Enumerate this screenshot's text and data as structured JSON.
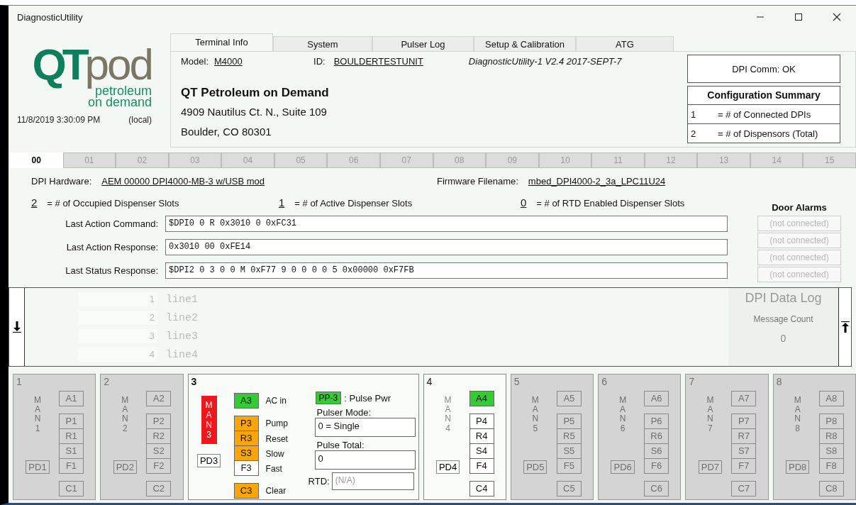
{
  "window": {
    "title": "DiagnosticUtility"
  },
  "logo": {
    "letters_1": "QT",
    "letters_2": "pod",
    "tagline_1": "petroleum",
    "tagline_2": "on demand"
  },
  "clock": {
    "time": "11/8/2019 3:30:09 PM",
    "zone": "(local)"
  },
  "tabs": [
    {
      "label": "Terminal Info",
      "selected": true
    },
    {
      "label": "System",
      "selected": false
    },
    {
      "label": "Pulser Log",
      "selected": false
    },
    {
      "label": "Setup & Calibration",
      "selected": false
    },
    {
      "label": "ATG",
      "selected": false
    }
  ],
  "terminal": {
    "model_label": "Model:",
    "model": "M4000",
    "id_label": "ID:",
    "id": "BOULDERTESTUNIT",
    "version": "DiagnosticUtility-1 V2.4 2017-SEPT-7",
    "company": "QT Petroleum on Demand",
    "address_1": "4909 Nautilus Ct. N., Suite 109",
    "address_2": "Boulder, CO 80301"
  },
  "comm_status": "DPI Comm: OK",
  "config_summary": {
    "title": "Configuration Summary",
    "rows": [
      {
        "count": "1",
        "label": "= # of Connected DPIs"
      },
      {
        "count": "2",
        "label": "= # of Dispensors (Total)"
      }
    ]
  },
  "dpi_tabs": [
    {
      "label": "00",
      "selected": true
    },
    {
      "label": "01",
      "selected": false
    },
    {
      "label": "02",
      "selected": false
    },
    {
      "label": "03",
      "selected": false
    },
    {
      "label": "04",
      "selected": false
    },
    {
      "label": "05",
      "selected": false
    },
    {
      "label": "06",
      "selected": false
    },
    {
      "label": "07",
      "selected": false
    },
    {
      "label": "08",
      "selected": false
    },
    {
      "label": "09",
      "selected": false
    },
    {
      "label": "10",
      "selected": false
    },
    {
      "label": "11",
      "selected": false
    },
    {
      "label": "12",
      "selected": false
    },
    {
      "label": "13",
      "selected": false
    },
    {
      "label": "14",
      "selected": false
    },
    {
      "label": "15",
      "selected": false
    }
  ],
  "dpi": {
    "hardware_label": "DPI Hardware:",
    "hardware": "AEM 00000 DPI4000-MB-3 w/USB mod",
    "firmware_label": "Firmware Filename:",
    "firmware": "mbed_DPI4000-2_3a_LPC11U24",
    "counts": [
      {
        "count": "2",
        "label": "= # of Occupied Dispenser Slots"
      },
      {
        "count": "1",
        "label": "= # of Active Dispenser Slots"
      },
      {
        "count": "0",
        "label": "= # of RTD Enabled Dispenser Slots"
      }
    ],
    "fields": [
      {
        "label": "Last Action Command:",
        "value": "$DPI0 0 R 0x3010 0 0xFC31"
      },
      {
        "label": "Last Action Response:",
        "value": "0x3010 00 0xFE14"
      },
      {
        "label": "Last Status Response:",
        "value": "$DPI2 0 3 0 0 M 0xF77 9 0 0 0 0 5 0x00000 0xF7FB"
      }
    ]
  },
  "door_alarms": {
    "title": "Door Alarms",
    "buttons": [
      {
        "label": "(not connected)",
        "disabled": true
      },
      {
        "label": "(not connected)",
        "disabled": true
      },
      {
        "label": "(not connected)",
        "disabled": true
      },
      {
        "label": "(not connected)",
        "disabled": true
      }
    ]
  },
  "data_log": {
    "lines": [
      {
        "number": "1",
        "text": "line1"
      },
      {
        "number": "2",
        "text": "line2"
      },
      {
        "number": "3",
        "text": "line3"
      },
      {
        "number": "4",
        "text": "line4"
      }
    ],
    "title": "DPI Data Log",
    "count_label": "Message Count",
    "count": "0"
  },
  "slots": [
    {
      "number": "1",
      "kind": "compact",
      "enabled": false,
      "man": "MAN1",
      "man_alarm": false,
      "pd": "PD1",
      "indicators": [
        {
          "label": "A1",
          "color": "#d4d4d4"
        },
        {
          "label": "P1",
          "color": "#d4d4d4"
        },
        {
          "label": "R1",
          "color": "#d4d4d4"
        },
        {
          "label": "S1",
          "color": "#d4d4d4"
        },
        {
          "label": "F1",
          "color": "#d4d4d4"
        },
        {
          "label": "C1",
          "color": "#d4d4d4"
        }
      ]
    },
    {
      "number": "2",
      "kind": "compact",
      "enabled": false,
      "man": "MAN2",
      "man_alarm": false,
      "pd": "PD2",
      "indicators": [
        {
          "label": "A2",
          "color": "#d4d4d4"
        },
        {
          "label": "P2",
          "color": "#d4d4d4"
        },
        {
          "label": "R2",
          "color": "#d4d4d4"
        },
        {
          "label": "S2",
          "color": "#d4d4d4"
        },
        {
          "label": "F2",
          "color": "#d4d4d4"
        },
        {
          "label": "C2",
          "color": "#d4d4d4"
        }
      ]
    },
    {
      "number": "3",
      "kind": "detailed",
      "enabled": true,
      "man": "MAN3",
      "man_alarm": true,
      "pd": "PD3",
      "indicators": [
        {
          "label": "A3",
          "color": "#33cc33",
          "caption": "AC in"
        },
        {
          "label": "P3",
          "color": "#ffa500",
          "caption": "Pump"
        },
        {
          "label": "R3",
          "color": "#ffa500",
          "caption": "Reset"
        },
        {
          "label": "S3",
          "color": "#ffa500",
          "caption": "Slow"
        },
        {
          "label": "F3",
          "color": "#ffffff",
          "caption": "Fast"
        },
        {
          "label": "C3",
          "color": "#ffa500",
          "caption": "Clear"
        }
      ],
      "pulse_power": {
        "badge": "PP-3",
        "color": "#33cc33",
        "label": ": Pulse Pwr"
      },
      "pulser_mode": {
        "label": "Pulser Mode:",
        "value": "0 = Single"
      },
      "pulse_total": {
        "label": "Pulse Total:",
        "value": "0"
      },
      "rtd": {
        "label": "RTD:",
        "value": "(N/A)",
        "disabled": true
      }
    },
    {
      "number": "4",
      "kind": "compact",
      "enabled": true,
      "man": "MAN4",
      "man_alarm": false,
      "pd": "PD4",
      "indicators": [
        {
          "label": "A4",
          "color": "#33cc33"
        },
        {
          "label": "P4",
          "color": "#ffffff"
        },
        {
          "label": "R4",
          "color": "#ffffff"
        },
        {
          "label": "S4",
          "color": "#ffffff"
        },
        {
          "label": "F4",
          "color": "#ffffff"
        },
        {
          "label": "C4",
          "color": "#ffffff"
        }
      ]
    },
    {
      "number": "5",
      "kind": "compact",
      "enabled": false,
      "man": "MAN5",
      "man_alarm": false,
      "pd": "PD5",
      "indicators": [
        {
          "label": "A5",
          "color": "#d4d4d4"
        },
        {
          "label": "P5",
          "color": "#d4d4d4"
        },
        {
          "label": "R5",
          "color": "#d4d4d4"
        },
        {
          "label": "S5",
          "color": "#d4d4d4"
        },
        {
          "label": "F5",
          "color": "#d4d4d4"
        },
        {
          "label": "C5",
          "color": "#d4d4d4"
        }
      ]
    },
    {
      "number": "6",
      "kind": "compact",
      "enabled": false,
      "man": "MAN6",
      "man_alarm": false,
      "pd": "PD6",
      "indicators": [
        {
          "label": "A6",
          "color": "#d4d4d4"
        },
        {
          "label": "P6",
          "color": "#d4d4d4"
        },
        {
          "label": "R6",
          "color": "#d4d4d4"
        },
        {
          "label": "S6",
          "color": "#d4d4d4"
        },
        {
          "label": "F6",
          "color": "#d4d4d4"
        },
        {
          "label": "C6",
          "color": "#d4d4d4"
        }
      ]
    },
    {
      "number": "7",
      "kind": "compact",
      "enabled": false,
      "man": "MAN7",
      "man_alarm": false,
      "pd": "PD7",
      "indicators": [
        {
          "label": "A7",
          "color": "#d4d4d4"
        },
        {
          "label": "P7",
          "color": "#d4d4d4"
        },
        {
          "label": "R7",
          "color": "#d4d4d4"
        },
        {
          "label": "S7",
          "color": "#d4d4d4"
        },
        {
          "label": "F7",
          "color": "#d4d4d4"
        },
        {
          "label": "C7",
          "color": "#d4d4d4"
        }
      ]
    },
    {
      "number": "8",
      "kind": "compact",
      "enabled": false,
      "man": "MAN8",
      "man_alarm": false,
      "pd": "PD8",
      "indicators": [
        {
          "label": "A8",
          "color": "#d4d4d4"
        },
        {
          "label": "P8",
          "color": "#d4d4d4"
        },
        {
          "label": "R8",
          "color": "#d4d4d4"
        },
        {
          "label": "S8",
          "color": "#d4d4d4"
        },
        {
          "label": "F8",
          "color": "#d4d4d4"
        },
        {
          "label": "C8",
          "color": "#d4d4d4"
        }
      ]
    }
  ]
}
